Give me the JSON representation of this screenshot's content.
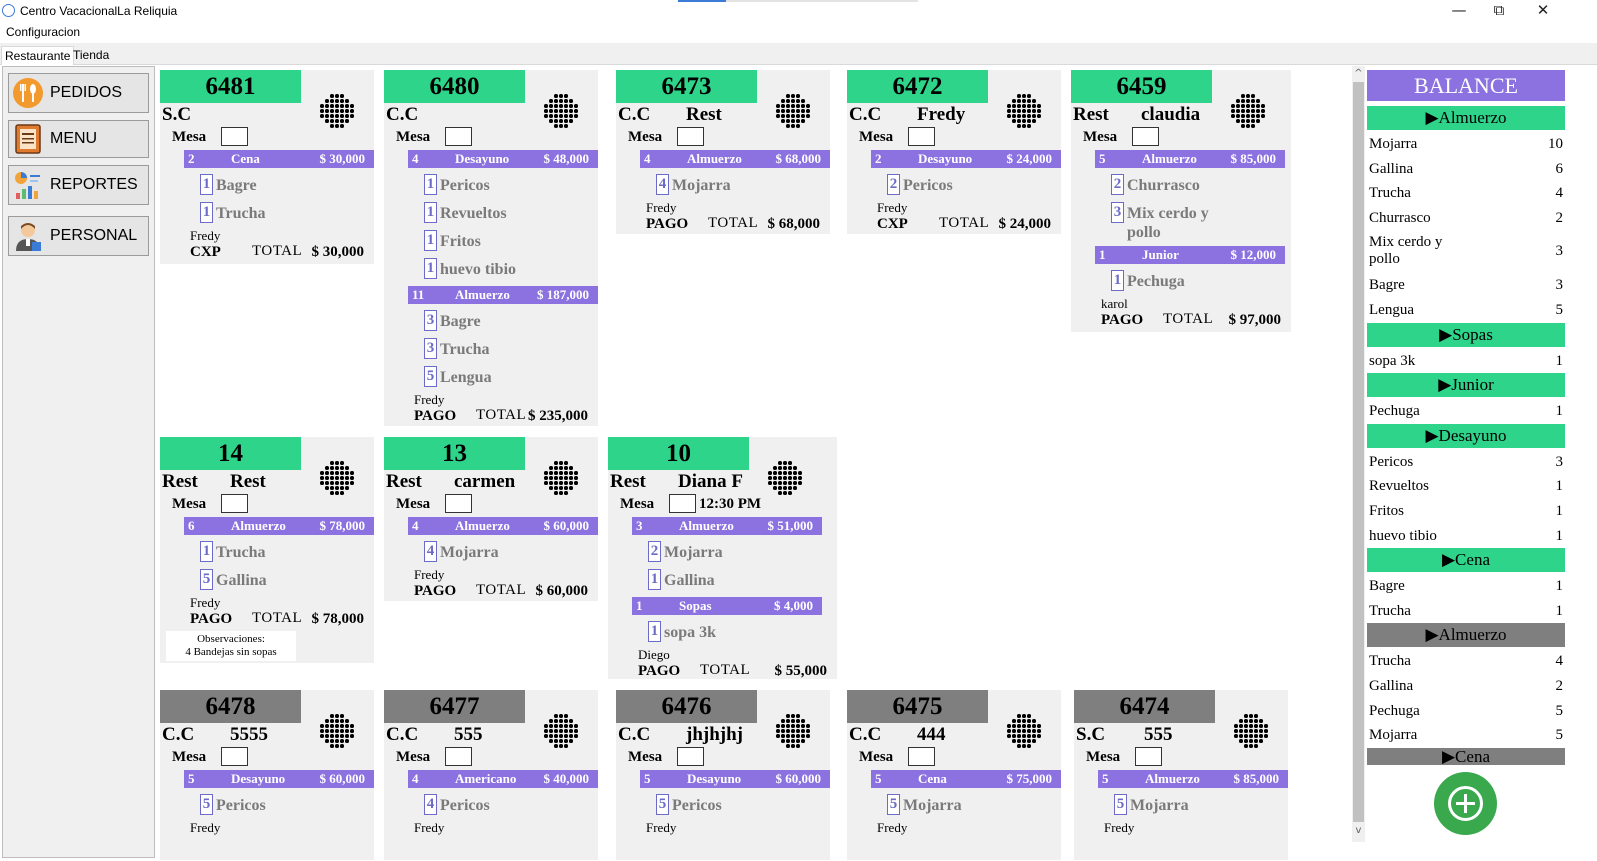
{
  "window": {
    "title": "Centro VacacionalLa Reliquia",
    "controls": [
      "—",
      "⧉",
      "✕"
    ]
  },
  "menu": {
    "config": "Configuracion"
  },
  "tabs": [
    "Restaurante",
    "Tienda"
  ],
  "nav": [
    {
      "label": "PEDIDOS",
      "icon": "food-icon"
    },
    {
      "label": "MENU",
      "icon": "menu-book-icon"
    },
    {
      "label": "REPORTES",
      "icon": "reports-icon"
    },
    {
      "label": "PERSONAL",
      "icon": "staff-icon"
    }
  ],
  "labels": {
    "mesa": "Mesa",
    "total": "TOTAL",
    "obs_title": "Observaciones:"
  },
  "orders": [
    {
      "id": "6481",
      "active": true,
      "t1": "S.C",
      "t2": "",
      "mesa_extra": "",
      "categories": [
        {
          "qty": "2",
          "name": "Cena",
          "price": "$ 30,000",
          "items": [
            {
              "qty": "1",
              "name": "Bagre"
            },
            {
              "qty": "1",
              "name": "Trucha"
            }
          ]
        }
      ],
      "waiter": "Fredy",
      "status": "CXP",
      "total": "$ 30,000"
    },
    {
      "id": "6480",
      "active": true,
      "t1": "C.C",
      "t2": "",
      "mesa_extra": "",
      "categories": [
        {
          "qty": "4",
          "name": "Desayuno",
          "price": "$ 48,000",
          "items": [
            {
              "qty": "1",
              "name": "Pericos"
            },
            {
              "qty": "1",
              "name": "Revueltos"
            },
            {
              "qty": "1",
              "name": "Fritos"
            },
            {
              "qty": "1",
              "name": "huevo tibio"
            }
          ]
        },
        {
          "qty": "11",
          "name": "Almuerzo",
          "price": "$ 187,000",
          "items": [
            {
              "qty": "3",
              "name": "Bagre"
            },
            {
              "qty": "3",
              "name": "Trucha"
            },
            {
              "qty": "5",
              "name": "Lengua"
            }
          ]
        }
      ],
      "waiter": "Fredy",
      "status": "PAGO",
      "total": "$ 235,000"
    },
    {
      "id": "6473",
      "active": true,
      "t1": "C.C",
      "t2": "Rest",
      "mesa_extra": "",
      "categories": [
        {
          "qty": "4",
          "name": "Almuerzo",
          "price": "$ 68,000",
          "items": [
            {
              "qty": "4",
              "name": "Mojarra"
            }
          ]
        }
      ],
      "waiter": "Fredy",
      "status": "PAGO",
      "total": "$ 68,000"
    },
    {
      "id": "6472",
      "active": true,
      "t1": "C.C",
      "t2": "Fredy",
      "mesa_extra": "",
      "categories": [
        {
          "qty": "2",
          "name": "Desayuno",
          "price": "$ 24,000",
          "items": [
            {
              "qty": "2",
              "name": "Pericos"
            }
          ]
        }
      ],
      "waiter": "Fredy",
      "status": "CXP",
      "total": "$ 24,000"
    },
    {
      "id": "6459",
      "active": true,
      "t1": "Rest",
      "t2": "claudia",
      "mesa_extra": "",
      "categories": [
        {
          "qty": "5",
          "name": "Almuerzo",
          "price": "$ 85,000",
          "items": [
            {
              "qty": "2",
              "name": "Churrasco"
            },
            {
              "qty": "3",
              "name": "Mix cerdo y",
              "name2": "pollo"
            }
          ]
        },
        {
          "qty": "1",
          "name": "Junior",
          "price": "$ 12,000",
          "items": [
            {
              "qty": "1",
              "name": "Pechuga"
            }
          ]
        }
      ],
      "waiter": "karol",
      "status": "PAGO",
      "total": "$ 97,000"
    },
    {
      "id": "14",
      "active": true,
      "t1": "Rest",
      "t2": "Rest",
      "mesa_extra": "",
      "categories": [
        {
          "qty": "6",
          "name": "Almuerzo",
          "price": "$ 78,000",
          "items": [
            {
              "qty": "1",
              "name": "Trucha"
            },
            {
              "qty": "5",
              "name": "Gallina"
            }
          ]
        }
      ],
      "waiter": "Fredy",
      "status": "PAGO",
      "total": "$ 78,000",
      "obs": "4 Bandejas sin sopas"
    },
    {
      "id": "13",
      "active": true,
      "t1": "Rest",
      "t2": "carmen",
      "mesa_extra": "",
      "categories": [
        {
          "qty": "4",
          "name": "Almuerzo",
          "price": "$ 60,000",
          "items": [
            {
              "qty": "4",
              "name": "Mojarra"
            }
          ]
        }
      ],
      "waiter": "Fredy",
      "status": "PAGO",
      "total": "$ 60,000"
    },
    {
      "id": "10",
      "active": true,
      "t1": "Rest",
      "t2": "Diana F",
      "mesa_extra": "12:30 PM",
      "categories": [
        {
          "qty": "3",
          "name": "Almuerzo",
          "price": "$ 51,000",
          "items": [
            {
              "qty": "2",
              "name": "Mojarra"
            },
            {
              "qty": "1",
              "name": "Gallina"
            }
          ]
        },
        {
          "qty": "1",
          "name": "Sopas",
          "price": "$ 4,000",
          "items": [
            {
              "qty": "1",
              "name": "sopa 3k"
            }
          ]
        }
      ],
      "waiter": "Diego",
      "status": "PAGO",
      "total": "$ 55,000"
    },
    {
      "id": "6478",
      "active": false,
      "t1": "C.C",
      "t2": "5555",
      "mesa_extra": "",
      "categories": [
        {
          "qty": "5",
          "name": "Desayuno",
          "price": "$ 60,000",
          "items": [
            {
              "qty": "5",
              "name": "Pericos"
            }
          ]
        }
      ],
      "waiter": "Fredy",
      "status": "",
      "total": ""
    },
    {
      "id": "6477",
      "active": false,
      "t1": "C.C",
      "t2": "555",
      "mesa_extra": "",
      "categories": [
        {
          "qty": "4",
          "name": "Americano",
          "price": "$ 40,000",
          "items": [
            {
              "qty": "4",
              "name": "Pericos"
            }
          ]
        }
      ],
      "waiter": "Fredy",
      "status": "",
      "total": ""
    },
    {
      "id": "6476",
      "active": false,
      "t1": "C.C",
      "t2": "jhjhjhj",
      "mesa_extra": "",
      "categories": [
        {
          "qty": "5",
          "name": "Desayuno",
          "price": "$ 60,000",
          "items": [
            {
              "qty": "5",
              "name": "Pericos"
            }
          ]
        }
      ],
      "waiter": "Fredy",
      "status": "",
      "total": ""
    },
    {
      "id": "6475",
      "active": false,
      "t1": "C.C",
      "t2": "444",
      "mesa_extra": "",
      "categories": [
        {
          "qty": "5",
          "name": "Cena",
          "price": "$ 75,000",
          "items": [
            {
              "qty": "5",
              "name": "Mojarra"
            }
          ]
        }
      ],
      "waiter": "Fredy",
      "status": "",
      "total": ""
    },
    {
      "id": "6474",
      "active": false,
      "t1": "S.C",
      "t2": "555",
      "mesa_extra": "",
      "categories": [
        {
          "qty": "5",
          "name": "Almuerzo",
          "price": "$ 85,000",
          "items": [
            {
              "qty": "5",
              "name": "Mojarra"
            }
          ]
        }
      ],
      "waiter": "Fredy",
      "status": "",
      "total": ""
    }
  ],
  "balance": {
    "title": "BALANCE",
    "groups": [
      {
        "name": "▶Almuerzo",
        "style": "active",
        "rows": [
          {
            "name": "Mojarra",
            "count": "10"
          },
          {
            "name": "Gallina",
            "count": "6"
          },
          {
            "name": "Trucha",
            "count": "4"
          },
          {
            "name": "Churrasco",
            "count": "2"
          },
          {
            "name": "Mix cerdo y",
            "name2": "pollo",
            "count": "3"
          },
          {
            "name": "Bagre",
            "count": "3"
          },
          {
            "name": "Lengua",
            "count": "5"
          }
        ]
      },
      {
        "name": "▶Sopas",
        "style": "active",
        "rows": [
          {
            "name": "sopa 3k",
            "count": "1"
          }
        ]
      },
      {
        "name": "▶Junior",
        "style": "active",
        "rows": [
          {
            "name": "Pechuga",
            "count": "1"
          }
        ]
      },
      {
        "name": "▶Desayuno",
        "style": "active",
        "rows": [
          {
            "name": "Pericos",
            "count": "3"
          },
          {
            "name": "Revueltos",
            "count": "1"
          },
          {
            "name": "Fritos",
            "count": "1"
          },
          {
            "name": "huevo tibio",
            "count": "1"
          }
        ]
      },
      {
        "name": "▶Cena",
        "style": "active",
        "rows": [
          {
            "name": "Bagre",
            "count": "1"
          },
          {
            "name": "Trucha",
            "count": "1"
          }
        ]
      },
      {
        "name": "▶Almuerzo",
        "style": "pending",
        "rows": [
          {
            "name": "Trucha",
            "count": "4"
          },
          {
            "name": "Gallina",
            "count": "2"
          },
          {
            "name": "Pechuga",
            "count": "5"
          },
          {
            "name": "Mojarra",
            "count": "5"
          }
        ]
      },
      {
        "name": "▶Cena",
        "style": "pending",
        "rows": []
      }
    ]
  },
  "colors": {
    "active_header": "#2ed48a",
    "pending_header": "#7f7f7f",
    "category_bar": "#8b72e0",
    "card_bg": "#f0f0f0",
    "add_button": "#3aa84d"
  }
}
